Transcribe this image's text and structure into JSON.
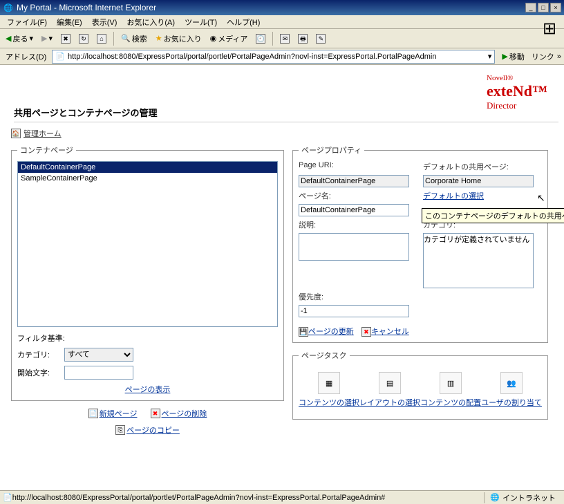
{
  "window": {
    "title": "My Portal - Microsoft Internet Explorer"
  },
  "menubar": [
    "ファイル(F)",
    "編集(E)",
    "表示(V)",
    "お気に入り(A)",
    "ツール(T)",
    "ヘルプ(H)"
  ],
  "toolbar": {
    "back": "戻る",
    "search": "検索",
    "favorites": "お気に入り",
    "media": "メディア"
  },
  "addressbar": {
    "label": "アドレス(D)",
    "url": "http://localhost:8080/ExpressPortal/portal/portlet/PortalPageAdmin?novl-inst=ExpressPortal.PortalPageAdmin",
    "go": "移動",
    "links": "リンク"
  },
  "brand": {
    "novell": "Novell®",
    "extend": "exteNd™",
    "director": "Director"
  },
  "page_title": "共用ページとコンテナページの管理",
  "admin_home": "管理ホーム",
  "container": {
    "legend": "コンテナページ",
    "items": [
      "DefaultContainerPage",
      "SampleContainerPage"
    ],
    "selected_index": 0
  },
  "filter": {
    "label": "フィルタ基準:",
    "category_label": "カテゴリ:",
    "category_value": "すべて",
    "start_label": "開始文字:",
    "start_value": "",
    "show_link": "ページの表示"
  },
  "actions": {
    "new_page": "新規ページ",
    "delete_page": "ページの削除",
    "copy_page": "ページのコピー"
  },
  "props": {
    "legend": "ページプロパティ",
    "uri_label": "Page URI:",
    "uri_value": "DefaultContainerPage",
    "default_shared_label": "デフォルトの共用ページ:",
    "default_shared_value": "Corporate Home",
    "name_label": "ページ名:",
    "name_value": "DefaultContainerPage",
    "select_default_link": "デフォルトの選択",
    "tooltip": "このコンテナページのデフォルトの共用ページを変更します",
    "desc_label": "説明:",
    "desc_value": "",
    "category_label": "カテゴリ:",
    "category_value": "カテゴリが定義されていません",
    "priority_label": "優先度:",
    "priority_value": "-1",
    "update": "ページの更新",
    "cancel": "キャンセル"
  },
  "tasks": {
    "legend": "ページタスク",
    "items": [
      "コンテンツの選択",
      "レイアウトの選択",
      "コンテンツの配置",
      "ユーザの割り当て"
    ]
  },
  "statusbar": {
    "url": "http://localhost:8080/ExpressPortal/portal/portlet/PortalPageAdmin?novl-inst=ExpressPortal.PortalPageAdmin#",
    "zone": "イントラネット"
  }
}
